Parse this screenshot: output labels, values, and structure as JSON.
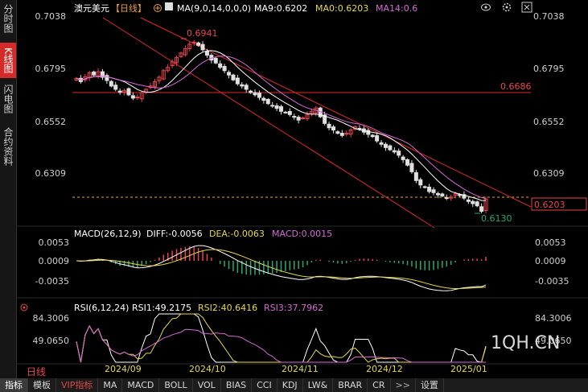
{
  "sidebar": {
    "tabs": [
      {
        "label": "分时图",
        "active": false
      },
      {
        "label": "K线图",
        "active": true
      },
      {
        "label": "闪电图",
        "active": false
      },
      {
        "label": "合约资料",
        "active": false
      }
    ]
  },
  "header": {
    "symbol": "澳元美元",
    "period": "【日线】",
    "add_icon": "plus-circle-icon",
    "ma_label": "MA(9,0,14,0,0,0)",
    "ma9": "MA9:0.6202",
    "ma0": "MA0:0.6203",
    "ma14": "MA14:0.6"
  },
  "top_right_icons": [
    "eye-icon",
    "settings-icon",
    "close-icon"
  ],
  "price_axis": [
    "0.7038",
    "0.6795",
    "0.6552",
    "0.6309"
  ],
  "price_annotations": {
    "high": "0.6941",
    "low": "0.6130",
    "resistance": "0.6686",
    "current": "0.6203"
  },
  "macd": {
    "label": "MACD(26,12,9)",
    "diff": "DIFF:-0.0056",
    "dea": "DEA:-0.0063",
    "macd": "MACD:0.0015",
    "axis": [
      "0.0053",
      "0.0009",
      "-0.0035"
    ]
  },
  "rsi": {
    "label": "RSI(6,12,24)",
    "rsi1": "RSI1:49.2175",
    "rsi2": "RSI2:40.6416",
    "rsi3": "RSI3:37.7962",
    "axis": [
      "84.3006",
      "49.0650"
    ]
  },
  "watermark": "1QH.CN",
  "period_button": "日线",
  "dates": [
    "2024/09",
    "2024/10",
    "2024/11",
    "2024/12",
    "2025/01"
  ],
  "bottom_tabs": [
    "指标",
    "模板",
    "VIP指标",
    "MA",
    "MACD",
    "BOLL",
    "VOL",
    "BIAS",
    "CCI",
    "KDJ",
    "LW&",
    "BRAR",
    "CR",
    ">>",
    "设置"
  ],
  "colors": {
    "up": "#e8454d",
    "down": "#e0e0e0",
    "ma_white": "#ffffff",
    "ma_yellow": "#e6d84a",
    "ma_purple": "#d46ad4",
    "trend": "#e02a2a",
    "macd_pos": "#e8454d",
    "macd_neg": "#2aa873",
    "current": "#e8a23a"
  },
  "chart_data": {
    "type": "candlestick",
    "xlabel": "",
    "ylabel": "",
    "date_ticks": [
      "2024/09",
      "2024/10",
      "2024/11",
      "2024/12",
      "2025/01"
    ],
    "ylim": [
      0.613,
      0.7038
    ],
    "close": [
      0.6755,
      0.674,
      0.6762,
      0.678,
      0.677,
      0.6785,
      0.676,
      0.6745,
      0.672,
      0.6705,
      0.6692,
      0.67,
      0.668,
      0.6665,
      0.667,
      0.669,
      0.6705,
      0.672,
      0.674,
      0.676,
      0.679,
      0.6805,
      0.683,
      0.685,
      0.687,
      0.689,
      0.691,
      0.692,
      0.6905,
      0.6885,
      0.686,
      0.6838,
      0.6825,
      0.6805,
      0.679,
      0.677,
      0.6748,
      0.673,
      0.672,
      0.6705,
      0.669,
      0.668,
      0.6668,
      0.6655,
      0.664,
      0.663,
      0.6618,
      0.6605,
      0.66,
      0.659,
      0.6578,
      0.6565,
      0.6575,
      0.659,
      0.6605,
      0.662,
      0.658,
      0.655,
      0.653,
      0.652,
      0.6505,
      0.6495,
      0.6505,
      0.652,
      0.6535,
      0.6525,
      0.651,
      0.65,
      0.649,
      0.647,
      0.6455,
      0.644,
      0.643,
      0.642,
      0.6405,
      0.6385,
      0.636,
      0.633,
      0.629,
      0.627,
      0.626,
      0.624,
      0.6235,
      0.6225,
      0.622,
      0.621,
      0.6215,
      0.623,
      0.6222,
      0.621,
      0.6195,
      0.6185,
      0.6175,
      0.615,
      0.6205
    ],
    "ma": [
      {
        "name": "MA9",
        "value": "0.6202"
      },
      {
        "name": "MA0",
        "value": "0.6203"
      },
      {
        "name": "MA14",
        "value": "0.6"
      }
    ]
  }
}
